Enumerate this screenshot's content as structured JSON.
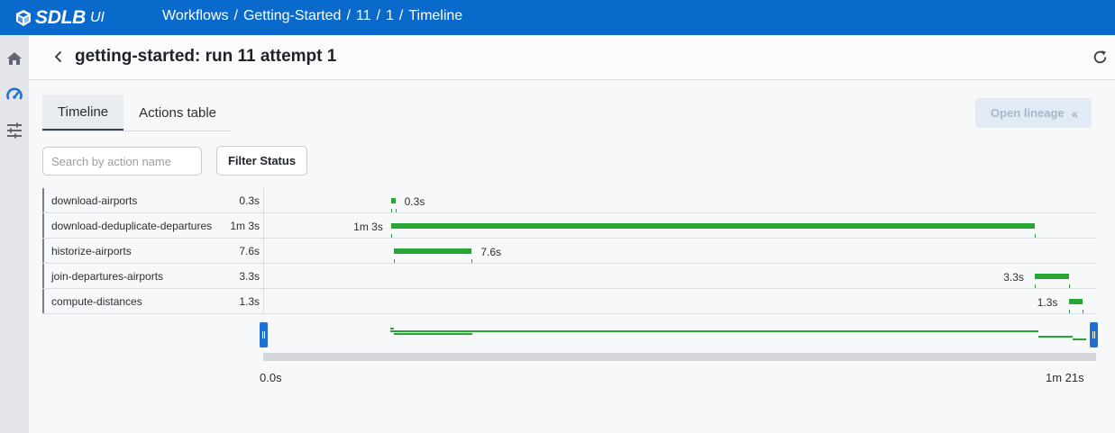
{
  "app": {
    "logo_text": "SDLB",
    "logo_sub": "UI"
  },
  "breadcrumb": [
    "Workflows",
    "Getting-Started",
    "11",
    "1",
    "Timeline"
  ],
  "header": {
    "title": "getting-started: run 11 attempt 1"
  },
  "tabs": [
    {
      "label": "Timeline",
      "active": true
    },
    {
      "label": "Actions table",
      "active": false
    }
  ],
  "toolbar": {
    "open_lineage_label": "Open lineage",
    "search_placeholder": "Search by action name",
    "filter_label": "Filter Status"
  },
  "timeline": {
    "rows": [
      {
        "name": "download-airports",
        "duration": "0.3s",
        "start_s": 0.0,
        "end_s": 0.3
      },
      {
        "name": "download-deduplicate-departures",
        "duration": "1m 3s",
        "start_s": 0.0,
        "end_s": 63.0
      },
      {
        "name": "historize-airports",
        "duration": "7.6s",
        "start_s": 0.3,
        "end_s": 7.9
      },
      {
        "name": "join-departures-airports",
        "duration": "3.3s",
        "start_s": 63.0,
        "end_s": 66.3
      },
      {
        "name": "compute-distances",
        "duration": "1.3s",
        "start_s": 66.3,
        "end_s": 67.6
      }
    ],
    "domain_s": [
      -12.4,
      68.6
    ],
    "axis_min_label": "0.0s",
    "axis_max_label": "1m 21s",
    "bar_color": "#27a636"
  },
  "colors": {
    "brand": "#0a6acb",
    "accent": "#1f6fd1"
  },
  "icons": {
    "home": "home-icon",
    "dashboard": "dashboard-icon",
    "settings": "sliders-icon",
    "back": "chevron-left-icon",
    "refresh": "refresh-icon"
  }
}
